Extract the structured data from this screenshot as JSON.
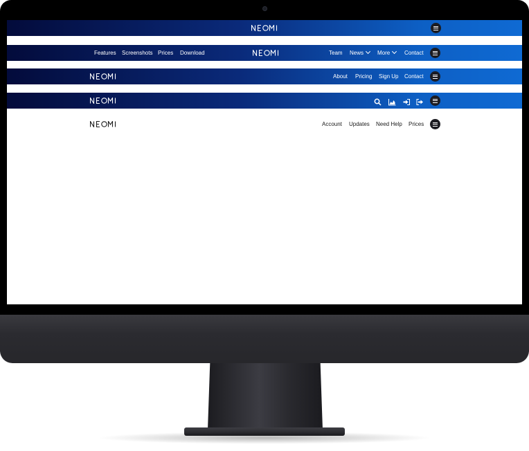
{
  "brand": {
    "logo_text": "NEOMI"
  },
  "navbars": [
    {
      "style": "gradient",
      "left_links": [],
      "right_links": [],
      "right_icons": []
    },
    {
      "style": "gradient",
      "left_links": [
        "Features",
        "Screenshots",
        "Prices",
        "Download"
      ],
      "right_links": [
        "Team",
        "News",
        "More",
        "Contact"
      ],
      "dropdown_links": [
        "News",
        "More"
      ]
    },
    {
      "style": "gradient",
      "left_links": [],
      "right_links": [
        "About",
        "Pricing",
        "Sign Up",
        "Contact"
      ]
    },
    {
      "style": "gradient",
      "left_links": [],
      "right_links": [],
      "right_icons": [
        "search-icon",
        "chart-icon",
        "sign-in-icon",
        "sign-out-icon"
      ]
    },
    {
      "style": "light",
      "left_links": [],
      "right_links": [
        "Account",
        "Updates",
        "Need Help",
        "Prices"
      ]
    }
  ],
  "menu_button": {
    "icon": "hamburger-icon"
  },
  "colors": {
    "bezel": "#000000",
    "gradient_start": "#030b3b",
    "gradient_end": "#0f6ad3",
    "menu_button": "#1c1c22",
    "chin": "#2b2b30"
  }
}
